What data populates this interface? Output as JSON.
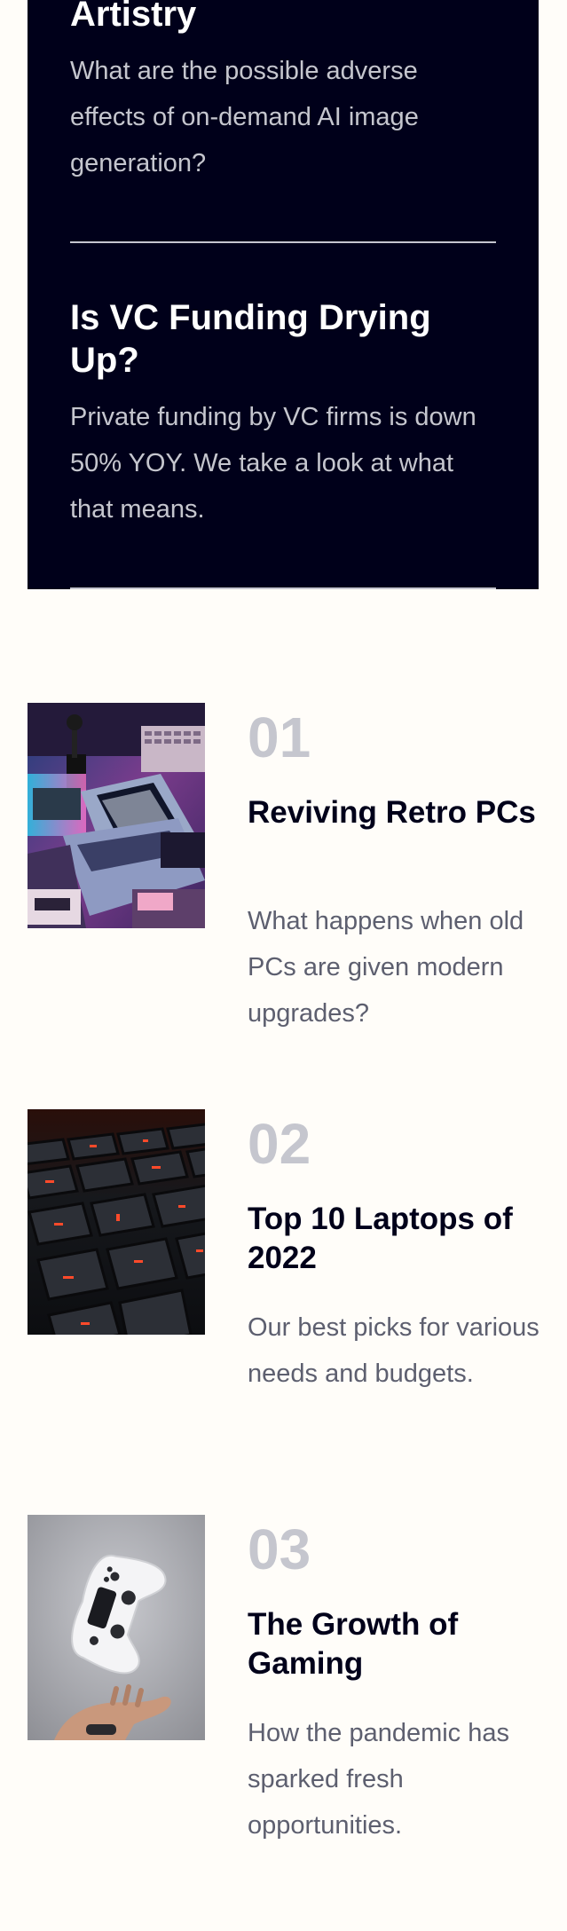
{
  "new_section": {
    "items": [
      {
        "title": "Artistry",
        "description": "What are the possible adverse effects of on-demand AI image generation?"
      },
      {
        "title": "Is VC Funding Drying Up?",
        "description": "Private funding by VC firms is down 50% YOY. We take a look at what that means."
      }
    ]
  },
  "articles": [
    {
      "number": "01",
      "title": "Reviving Retro PCs",
      "description": "What happens when old PCs are given modern upgrades?",
      "image": "retro-pc-image"
    },
    {
      "number": "02",
      "title": "Top 10 Laptops of 2022",
      "description": "Our best picks for various needs and budgets.",
      "image": "laptop-keyboard-image"
    },
    {
      "number": "03",
      "title": "The Growth of Gaming",
      "description": "How the pandemic has sparked fresh opportunities.",
      "image": "game-controller-image"
    }
  ]
}
